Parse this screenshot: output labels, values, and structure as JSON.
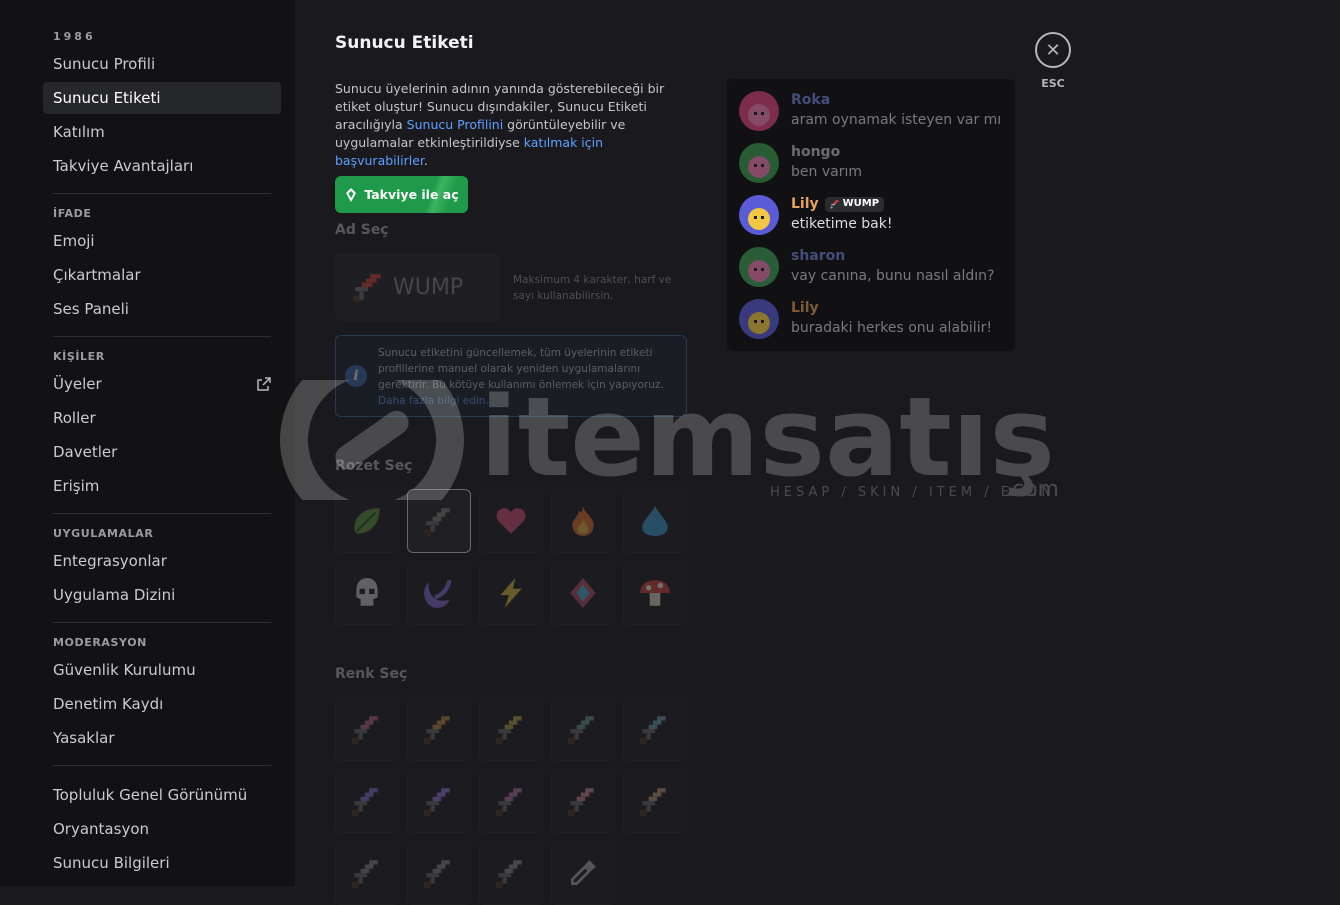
{
  "sidebar": {
    "server_name": "1986",
    "group1": [
      {
        "label": "Sunucu Profili",
        "active": false
      },
      {
        "label": "Sunucu Etiketi",
        "active": true
      },
      {
        "label": "Katılım",
        "active": false
      },
      {
        "label": "Takviye Avantajları",
        "active": false
      }
    ],
    "heading_ifade": "İFADE",
    "group2": [
      {
        "label": "Emoji"
      },
      {
        "label": "Çıkartmalar"
      },
      {
        "label": "Ses Paneli"
      }
    ],
    "heading_kisiler": "KİŞİLER",
    "group3": [
      {
        "label": "Üyeler",
        "external": true
      },
      {
        "label": "Roller"
      },
      {
        "label": "Davetler"
      },
      {
        "label": "Erişim"
      }
    ],
    "heading_uygulamalar": "UYGULAMALAR",
    "group4": [
      {
        "label": "Entegrasyonlar"
      },
      {
        "label": "Uygulama Dizini"
      }
    ],
    "heading_moderasyon": "MODERASYON",
    "group5": [
      {
        "label": "Güvenlik Kurulumu"
      },
      {
        "label": "Denetim Kaydı"
      },
      {
        "label": "Yasaklar"
      }
    ],
    "group6": [
      {
        "label": "Topluluk Genel Görünümü"
      },
      {
        "label": "Oryantasyon"
      },
      {
        "label": "Sunucu Bilgileri"
      }
    ]
  },
  "main": {
    "title": "Sunucu Etiketi",
    "desc_1": "Sunucu üyelerinin adının yanında gösterebileceği bir etiket oluştur! Sunucu dışındakiler, Sunucu Etiketi aracılığıyla ",
    "desc_link1": "Sunucu Profilini",
    "desc_2": " görüntüleyebilir ve uygulamalar etkinleştirildiyse ",
    "desc_link2": "katılmak için başvurabilirler",
    "desc_3": ".",
    "boost_button": "Takviye ile aç",
    "name_label": "Ad Seç",
    "name_value": "WUMP",
    "name_hint": "Maksimum 4 karakter, harf ve sayı kullanabilirsin.",
    "info_text": "Sunucu etiketini güncellemek, tüm üyelerinin etiketi profillerine manuel olarak yeniden uygulamalarını gerektirir. Bu kötüye kullanımı önlemek için yapıyoruz. ",
    "info_link": "Daha fazla bilgi edin.",
    "badge_label": "Rozet Seç",
    "color_label": "Renk Seç",
    "badges": [
      "leaf-icon",
      "sword-icon",
      "heart-icon",
      "fire-icon",
      "water-drop-icon",
      "skull-icon",
      "moon-icon",
      "lightning-icon",
      "gem-icon",
      "mushroom-icon"
    ],
    "badge_colors": [
      "#5f9e3f",
      "#8a8a7a",
      "#e0527e",
      "#e8782f",
      "#3fa3d8",
      "#d6d6d6",
      "#8b6fe0",
      "#e3c244",
      "#c0506a",
      "#d9463c"
    ],
    "sword_colors": [
      "#c36a8e",
      "#c98a47",
      "#b9a84a",
      "#5fa48a",
      "#6fa3b6",
      "#8a7ad6",
      "#9a7ae0",
      "#b57aa8",
      "#d88a98",
      "#c59a7a",
      "#8a8f86",
      "#8f8a8f",
      "#8d8f96"
    ],
    "close_label": "ESC"
  },
  "chat": [
    {
      "user": "Roka",
      "text": "aram oynamak isteyen var mı",
      "user_color": "#7a8be0",
      "faded": true,
      "avatar": "#d2447a"
    },
    {
      "user": "hongo",
      "text": "ben varım",
      "user_color": "#c4c6cc",
      "faded": true,
      "avatar": "#3e9a4c"
    },
    {
      "user": "Lily",
      "text": "etiketime bak!",
      "user_color": "#e8a25c",
      "faded": false,
      "avatar": "#5a5bd6",
      "tag": "WUMP"
    },
    {
      "user": "sharon",
      "text": "vay canına, bunu nasıl aldın?",
      "user_color": "#7a8be0",
      "faded": true,
      "avatar": "#3f9b55"
    },
    {
      "user": "Lily",
      "text": "buradaki herkes onu alabilir!",
      "user_color": "#e8a25c",
      "faded": true,
      "avatar": "#5a5bd6"
    }
  ],
  "watermark": {
    "brand": "itemsatış",
    "tagline": "HESAP / SKIN / ITEM / E-PIN",
    "suffix": ".com"
  }
}
